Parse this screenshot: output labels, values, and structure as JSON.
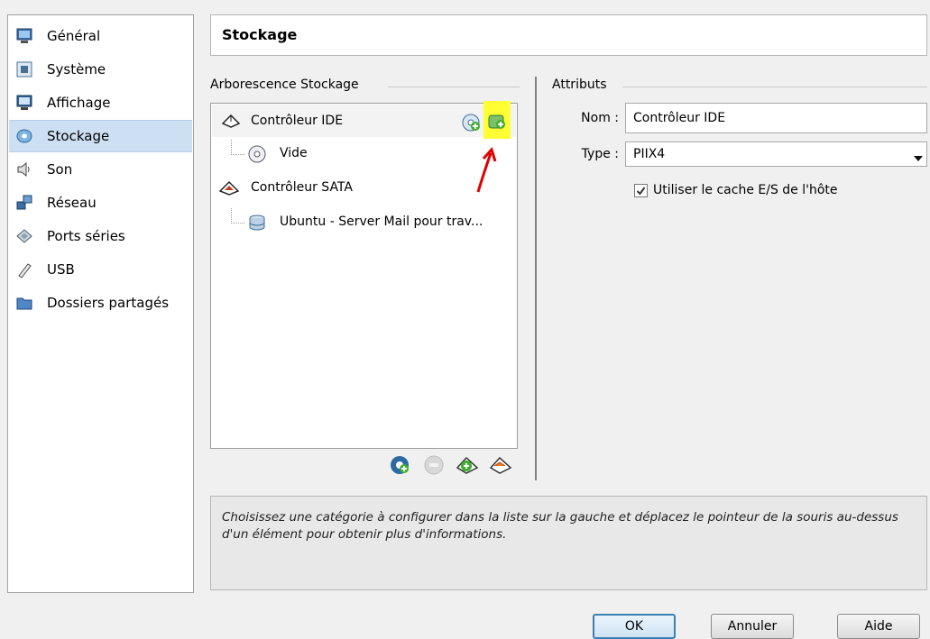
{
  "sidebar": {
    "items": [
      {
        "label": "Général",
        "icon": "monitor-icon"
      },
      {
        "label": "Système",
        "icon": "chip-icon"
      },
      {
        "label": "Affichage",
        "icon": "display-icon"
      },
      {
        "label": "Stockage",
        "icon": "disk-icon"
      },
      {
        "label": "Son",
        "icon": "speaker-icon"
      },
      {
        "label": "Réseau",
        "icon": "network-icon"
      },
      {
        "label": "Ports séries",
        "icon": "serial-port-icon"
      },
      {
        "label": "USB",
        "icon": "usb-icon"
      },
      {
        "label": "Dossiers partagés",
        "icon": "folder-icon"
      }
    ],
    "selected": "Stockage"
  },
  "header": {
    "title": "Stockage"
  },
  "storage_tree": {
    "group_title": "Arborescence Stockage",
    "controllers": [
      {
        "name": "Contrôleur IDE",
        "children": [
          {
            "name": "Vide",
            "icon": "empty-cd-icon"
          }
        ]
      },
      {
        "name": "Contrôleur SATA",
        "children": [
          {
            "name": "Ubuntu - Server Mail pour trav...",
            "icon": "hard-disk-icon"
          }
        ]
      }
    ],
    "inline_buttons": [
      "add-cd-icon",
      "add-hard-disk-icon"
    ],
    "toolbar": [
      "add-attachment-icon",
      "remove-attachment-icon",
      "add-controller-icon",
      "remove-controller-icon"
    ]
  },
  "attributes": {
    "group_title": "Attributs",
    "name_label": "Nom :",
    "name_value": "Contrôleur IDE",
    "type_label": "Type :",
    "type_value": "PIIX4",
    "cache_label": "Utiliser le cache E/S de l'hôte",
    "cache_checked": true
  },
  "info_text": "Choisissez une catégorie à configurer dans la liste sur la gauche et déplacez le pointeur de la souris au-dessus d'un élément pour obtenir plus d'informations.",
  "buttons": {
    "ok": "OK",
    "cancel": "Annuler",
    "help": "Aide"
  },
  "colors": {
    "selection": "#cddff2",
    "highlight": "#ffff33",
    "annotation": "#e00000"
  }
}
